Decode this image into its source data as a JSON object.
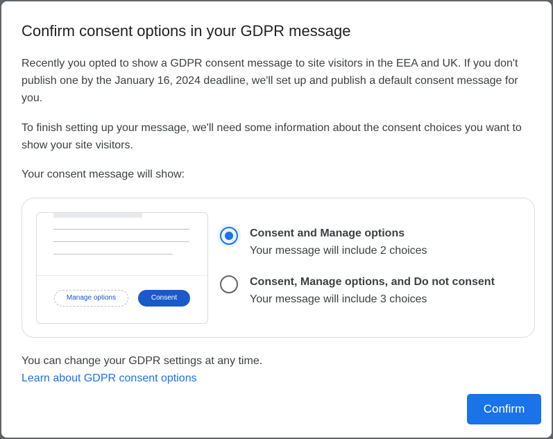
{
  "dialog": {
    "title": "Confirm consent options in your GDPR message",
    "paragraph1": "Recently you opted to show a GDPR consent message to site visitors in the EEA and UK. If you don't publish one by the January 16, 2024 deadline, we'll set up and publish a default consent message for you.",
    "paragraph2": "To finish setting up your message, we'll need some information about the consent choices you want to show your site visitors.",
    "paragraph3": "Your consent message will show:",
    "preview": {
      "manage_label": "Manage options",
      "consent_label": "Consent"
    },
    "options": [
      {
        "title": "Consent and Manage options",
        "description": "Your message will include 2 choices",
        "selected": true
      },
      {
        "title": "Consent, Manage options, and Do not consent",
        "description": "Your message will include 3 choices",
        "selected": false
      }
    ],
    "footer_text": "You can change your GDPR settings at any time.",
    "learn_link": "Learn about GDPR consent options",
    "confirm_label": "Confirm"
  },
  "colors": {
    "accent": "#1a73e8",
    "preview_button": "#1a5ac8",
    "text": "#3c4043",
    "border": "#dadce0"
  }
}
